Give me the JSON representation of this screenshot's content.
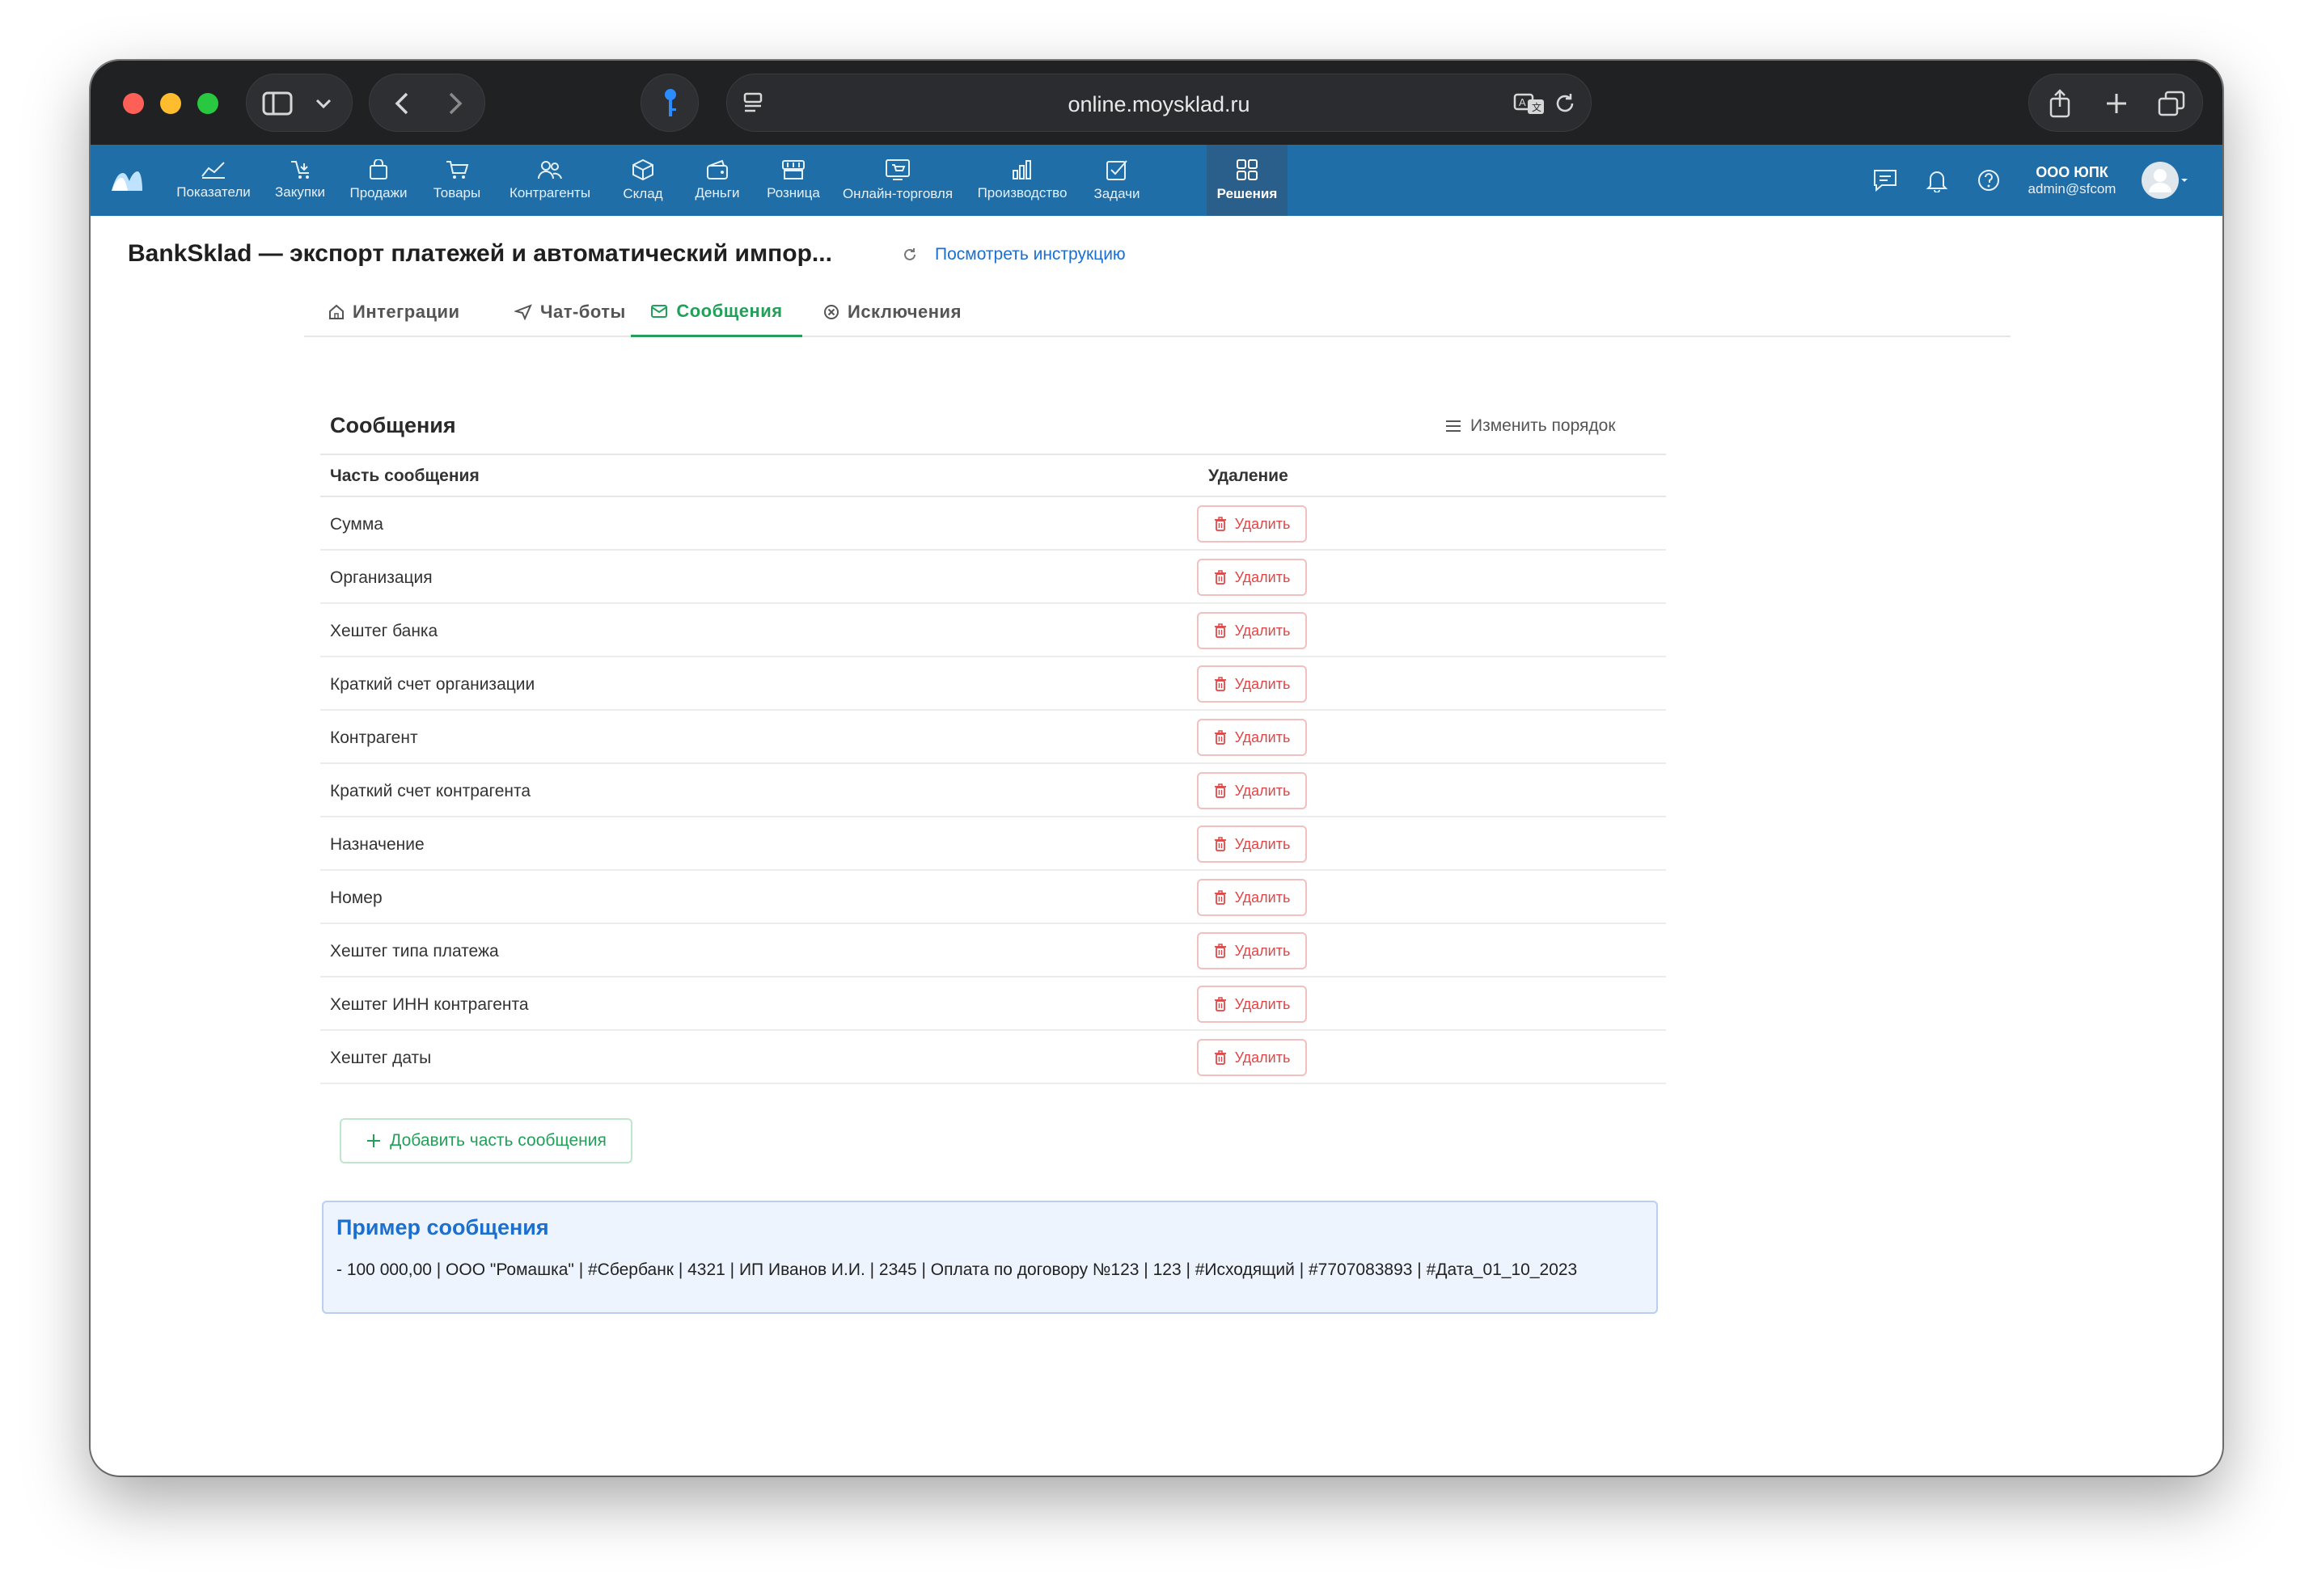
{
  "browser": {
    "url": "online.moysklad.ru"
  },
  "nav": {
    "items": [
      {
        "label": "Показатели",
        "icon": "chart-line-icon"
      },
      {
        "label": "Закупки",
        "icon": "purchase-icon"
      },
      {
        "label": "Продажи",
        "icon": "shopping-bag-icon"
      },
      {
        "label": "Товары",
        "icon": "cart-icon"
      },
      {
        "label": "Контрагенты",
        "icon": "people-icon"
      },
      {
        "label": "Склад",
        "icon": "box-icon"
      },
      {
        "label": "Деньги",
        "icon": "wallet-icon"
      },
      {
        "label": "Розница",
        "icon": "register-icon"
      },
      {
        "label": "Онлайн-торговля",
        "icon": "online-store-icon"
      },
      {
        "label": "Производство",
        "icon": "bars-icon"
      },
      {
        "label": "Задачи",
        "icon": "checkbox-icon"
      },
      {
        "label": "Решения",
        "icon": "grid-icon"
      }
    ],
    "active": "Решения",
    "company": "ООО ЮПК",
    "user": "admin@sfcom"
  },
  "page": {
    "title": "BankSklad — экспорт платежей и автоматический импор...",
    "instruction_link": "Посмотреть инструкцию"
  },
  "tabs": [
    {
      "label": "Интеграции",
      "icon": "home-icon"
    },
    {
      "label": "Чат-боты",
      "icon": "send-icon"
    },
    {
      "label": "Сообщения",
      "icon": "mail-icon"
    },
    {
      "label": "Исключения",
      "icon": "x-circle-icon"
    }
  ],
  "active_tab": "Сообщения",
  "card": {
    "title": "Сообщения",
    "reorder_label": "Изменить порядок",
    "col_part": "Часть сообщения",
    "col_delete": "Удаление",
    "delete_label": "Удалить",
    "rows": [
      "Сумма",
      "Организация",
      "Хештег банка",
      "Краткий счет организации",
      "Контрагент",
      "Краткий счет контрагента",
      "Назначение",
      "Номер",
      "Хештег типа платежа",
      "Хештег ИНН контрагента",
      "Хештег даты"
    ],
    "add_label": "Добавить часть сообщения"
  },
  "example": {
    "title": "Пример сообщения",
    "text": "- 100 000,00 | ООО \"Ромашка\" | #Сбербанк | 4321 | ИП Иванов И.И. | 2345 | Оплата по договору №123 | 123 | #Исходящий | #7707083893 | #Дата_01_10_2023"
  },
  "colors": {
    "nav_bg": "#1f6ea8",
    "active_tab": "#22a05a",
    "danger": "#e04646",
    "link": "#1a6fcf"
  }
}
